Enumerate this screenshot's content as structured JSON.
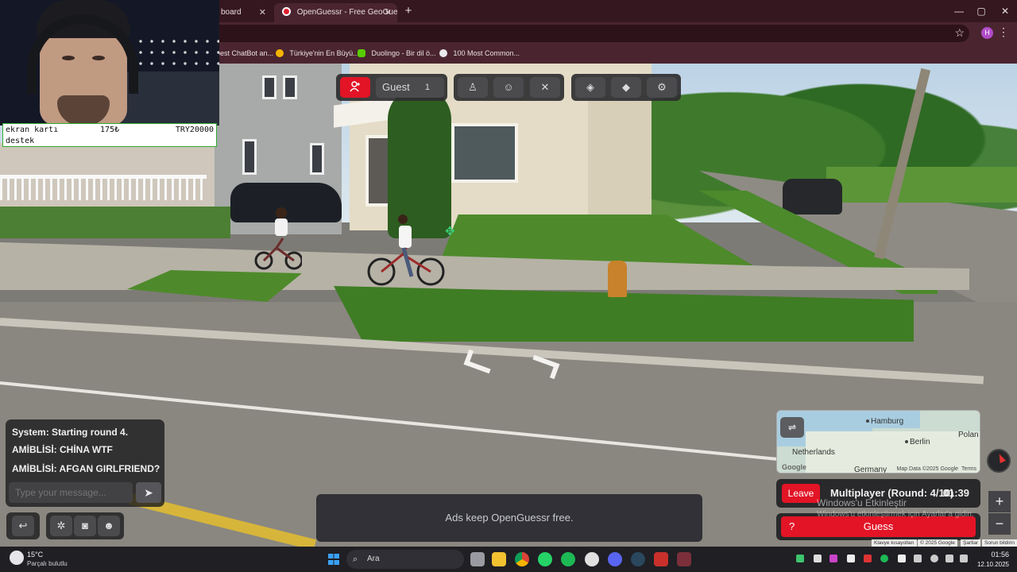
{
  "browser": {
    "tabs": [
      {
        "label": "board",
        "active": false
      },
      {
        "label": "OpenGuessr - Free GeoGuessr",
        "active": true
      }
    ],
    "new_tab_icon": "+",
    "window_controls": {
      "minimize": "—",
      "maximize": "▢",
      "close": "✕"
    },
    "profile_initial": "H",
    "bookmarks": [
      {
        "label": "best ChatBot an...",
        "icon_color": "#8ab4f8"
      },
      {
        "label": "Türkiye'nin En Büyü...",
        "icon_color": "#f5b400"
      },
      {
        "label": "Duolingo - Bir dil ö...",
        "icon_color": "#58cc02"
      },
      {
        "label": "100 Most Common...",
        "icon_color": "#e8eaed"
      }
    ]
  },
  "overlay": {
    "donation": {
      "item": "ekran kartı",
      "price": "175₺",
      "goal": "TRY20000",
      "line2": "destek"
    }
  },
  "hud": {
    "player_name": "Guest",
    "player_count": "1",
    "icons": [
      "add-user-icon",
      "player-icon",
      "party-icon",
      "crossed-swords-icon",
      "layers-icon",
      "cap-icon",
      "settings-icon"
    ]
  },
  "chat": {
    "messages": [
      "System: Starting round 4.",
      "AMİBLİSİ: CHİNA WTF",
      "AMİBLİSİ: AFGAN GIRLFRIEND?"
    ],
    "placeholder": "Type your message...",
    "send_icon": "➤"
  },
  "ads": {
    "text": "Ads keep OpenGuessr free."
  },
  "minimap": {
    "labels": {
      "city1": "Hamburg",
      "city2": "Berlin",
      "country1": "Netherlands",
      "country2": "Germany",
      "country3": "Polan"
    },
    "attribution": "Map Data ©2025 Google",
    "terms": "Terms",
    "google_logo": "Google"
  },
  "status": {
    "leave_label": "Leave",
    "round_text": "Multiplayer (Round: 4/10)",
    "timer": "01:39"
  },
  "guess": {
    "label": "Guess",
    "icon": "?"
  },
  "windows_watermark": {
    "title": "Windows'u Etkinleştir",
    "subtitle": "Windows'u etkinleştirmek için Ayarlar'a gidin."
  },
  "zoom": {
    "in": "+",
    "out": "−"
  },
  "google_footer": {
    "shortcuts": "Klavye kısayolları",
    "copyright": "© 2025 Google",
    "terms": "Şartlar",
    "report": "Sorun bildirin"
  },
  "taskbar": {
    "weather_temp": "15°C",
    "weather_desc": "Parçalı bulutlu",
    "search_placeholder": "Ara",
    "time": "01:56",
    "date": "12.10.2025"
  }
}
